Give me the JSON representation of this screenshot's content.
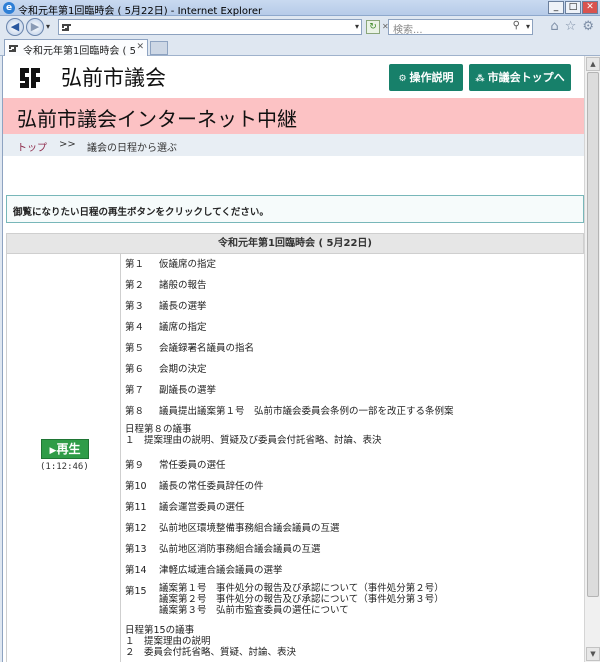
{
  "browser": {
    "window_title": "令和元年第1回臨時会 ( 5月22日) - Internet Explorer",
    "window_buttons": [
      "_",
      "□",
      "✕"
    ],
    "search_placeholder": "検索...",
    "tab_label": "令和元年第1回臨時会 ( 5月...",
    "tab_close": "✕"
  },
  "site": {
    "name": "弘前市議会",
    "help_button": "操作説明",
    "top_button": "市議会トップへ",
    "heading": "弘前市議会インターネット中継"
  },
  "breadcrumb": {
    "top_link": "トップ",
    "separator": ">>",
    "current": "議会の日程から選ぶ"
  },
  "notice": "御覧になりたい日程の再生ボタンをクリックしてください。",
  "meeting": {
    "title": "令和元年第1回臨時会 ( 5月22日)",
    "play_label": "再生",
    "duration": "(1:12:46)",
    "items": [
      {
        "no": "第１",
        "text": "仮議席の指定"
      },
      {
        "no": "第２",
        "text": "諸般の報告"
      },
      {
        "no": "第３",
        "text": "議長の選挙"
      },
      {
        "no": "第４",
        "text": "議席の指定"
      },
      {
        "no": "第５",
        "text": "会議録署名議員の指名"
      },
      {
        "no": "第６",
        "text": "会期の決定"
      },
      {
        "no": "第７",
        "text": "副議長の選挙"
      },
      {
        "no": "第８",
        "text": "議員提出議案第１号　弘前市議会委員会条例の一部を改正する条例案"
      },
      {
        "no": "",
        "text": "日程第８の議事\n１　提案理由の説明、質疑及び委員会付託省略、討論、表決"
      },
      {
        "no": "第９",
        "text": "常任委員の選任"
      },
      {
        "no": "第10",
        "text": "議長の常任委員辞任の件"
      },
      {
        "no": "第11",
        "text": "議会運営委員の選任"
      },
      {
        "no": "第12",
        "text": "弘前地区環境整備事務組合議会議員の互選"
      },
      {
        "no": "第13",
        "text": "弘前地区消防事務組合議会議員の互選"
      },
      {
        "no": "第14",
        "text": "津軽広域連合議会議員の選挙"
      },
      {
        "no": "第15",
        "text": "議案第１号　事件処分の報告及び承認について（事件処分第２号）\n議案第２号　事件処分の報告及び承認について（事件処分第３号）\n議案第３号　弘前市監査委員の選任について"
      },
      {
        "no": "",
        "text": "日程第15の議事\n１　提案理由の説明\n２　委員会付託省略、質疑、討論、表決"
      }
    ]
  }
}
